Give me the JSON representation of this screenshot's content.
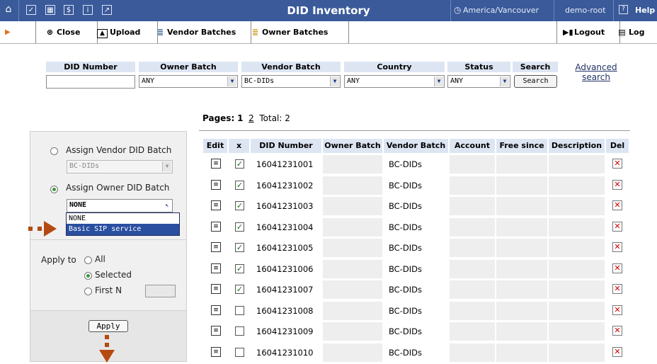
{
  "titlebar": {
    "title": "DID Inventory",
    "timezone": "America/Vancouver",
    "user": "demo-root",
    "help": "Help"
  },
  "toolbar": {
    "close": "Close",
    "upload": "Upload",
    "vendor_batches": "Vendor Batches",
    "owner_batches": "Owner Batches",
    "logout": "Logout",
    "log": "Log"
  },
  "search": {
    "headers": {
      "did_number": "DID Number",
      "owner_batch": "Owner Batch",
      "vendor_batch": "Vendor Batch",
      "country": "Country",
      "status": "Status",
      "search": "Search"
    },
    "did_number_value": "",
    "owner_batch_value": "ANY",
    "vendor_batch_value": "BC-DIDs",
    "country_value": "ANY",
    "status_value": "ANY",
    "search_button": "Search",
    "advanced_1": "Advanced",
    "advanced_2": "search"
  },
  "pager": {
    "label": "Pages:",
    "current": "1",
    "next": "2",
    "total": "Total: 2"
  },
  "panel": {
    "assign_vendor": "Assign Vendor DID Batch",
    "vendor_select_value": "BC-DIDs",
    "assign_owner": "Assign Owner DID Batch",
    "owner_select_value": "NONE",
    "dropdown_options": [
      "NONE",
      "Basic SIP service"
    ],
    "apply_to": "Apply to",
    "opt_all": "All",
    "opt_selected": "Selected",
    "opt_first_n": "First N",
    "first_n_value": "",
    "apply_button": "Apply"
  },
  "table": {
    "headers": {
      "edit": "Edit",
      "x": "x",
      "did_number": "DID Number",
      "owner_batch": "Owner Batch",
      "vendor_batch": "Vendor Batch",
      "account": "Account",
      "free_since": "Free since",
      "description": "Description",
      "del": "Del"
    },
    "rows": [
      {
        "did": "16041231001",
        "vendor": "BC-DIDs",
        "checked": true
      },
      {
        "did": "16041231002",
        "vendor": "BC-DIDs",
        "checked": true
      },
      {
        "did": "16041231003",
        "vendor": "BC-DIDs",
        "checked": true
      },
      {
        "did": "16041231004",
        "vendor": "BC-DIDs",
        "checked": true
      },
      {
        "did": "16041231005",
        "vendor": "BC-DIDs",
        "checked": true
      },
      {
        "did": "16041231006",
        "vendor": "BC-DIDs",
        "checked": true
      },
      {
        "did": "16041231007",
        "vendor": "BC-DIDs",
        "checked": true
      },
      {
        "did": "16041231008",
        "vendor": "BC-DIDs",
        "checked": false
      },
      {
        "did": "16041231009",
        "vendor": "BC-DIDs",
        "checked": false
      },
      {
        "did": "16041231010",
        "vendor": "BC-DIDs",
        "checked": false
      }
    ]
  },
  "colors": {
    "titlebar": "#3a5a9a",
    "header_fill": "#dde5f3",
    "selection": "#2a4fa0",
    "annotation": "#b54a10"
  }
}
